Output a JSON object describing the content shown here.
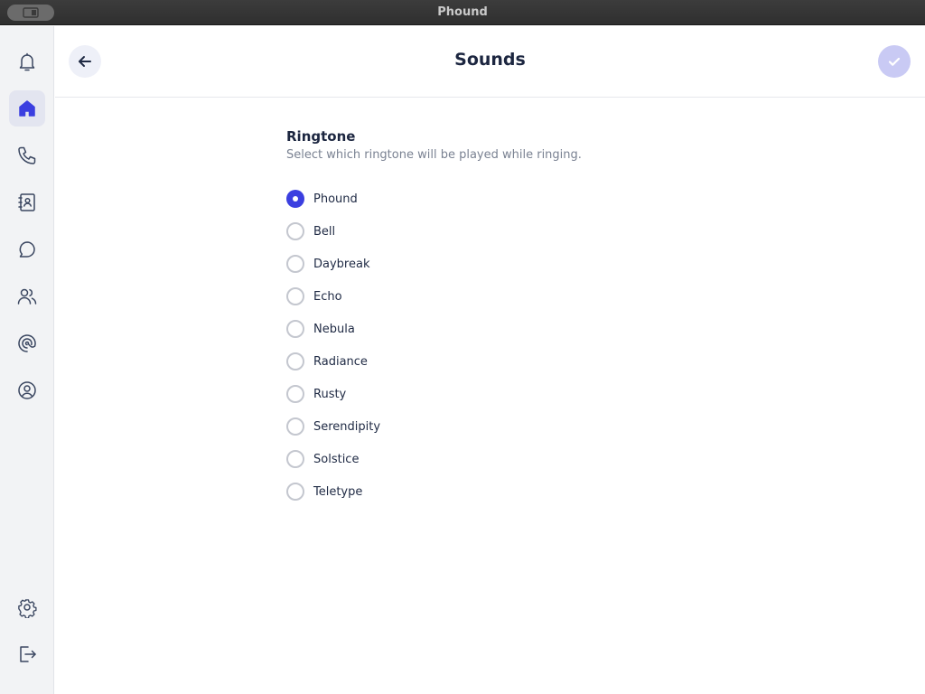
{
  "window": {
    "title": "Phound"
  },
  "sidebar": {
    "items": [
      {
        "name": "notifications",
        "icon": "bell-icon",
        "active": false
      },
      {
        "name": "home",
        "icon": "home-icon",
        "active": true
      },
      {
        "name": "calls",
        "icon": "phone-icon",
        "active": false
      },
      {
        "name": "contacts",
        "icon": "contacts-book-icon",
        "active": false
      },
      {
        "name": "messages",
        "icon": "chat-bubble-icon",
        "active": false
      },
      {
        "name": "team",
        "icon": "users-icon",
        "active": false
      },
      {
        "name": "phound",
        "icon": "phound-logo-icon",
        "active": false
      },
      {
        "name": "profile",
        "icon": "user-circle-icon",
        "active": false
      },
      {
        "name": "settings",
        "icon": "gear-icon",
        "active": false
      },
      {
        "name": "logout",
        "icon": "logout-icon",
        "active": false
      }
    ]
  },
  "header": {
    "title": "Sounds",
    "back_icon": "arrow-left-icon",
    "confirm_icon": "check-icon"
  },
  "ringtone": {
    "title": "Ringtone",
    "description": "Select which ringtone will be played while ringing.",
    "selected": "Phound",
    "options": [
      "Phound",
      "Bell",
      "Daybreak",
      "Echo",
      "Nebula",
      "Radiance",
      "Rusty",
      "Serendipity",
      "Solstice",
      "Teletype"
    ]
  },
  "colors": {
    "accent": "#3b3fe0",
    "confirm_disabled": "#c9caf4",
    "sidebar_bg": "#f2f3f5"
  }
}
